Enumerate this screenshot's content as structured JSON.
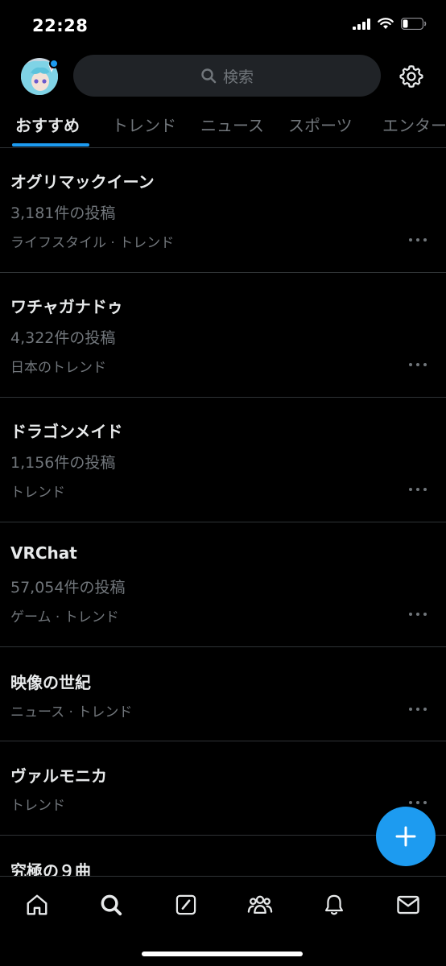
{
  "status_bar": {
    "time": "22:28"
  },
  "search": {
    "placeholder": "検索"
  },
  "tabs": [
    {
      "label": "おすすめ",
      "active": true
    },
    {
      "label": "トレンド"
    },
    {
      "label": "ニュース"
    },
    {
      "label": "スポーツ"
    },
    {
      "label": "エンター"
    }
  ],
  "trends": [
    {
      "title": "オグリマックイーン",
      "count": "3,181件の投稿",
      "context": "ライフスタイル · トレンド"
    },
    {
      "title": "ワチャガナドゥ",
      "count": "4,322件の投稿",
      "context": "日本のトレンド"
    },
    {
      "title": "ドラゴンメイド",
      "count": "1,156件の投稿",
      "context": "トレンド"
    },
    {
      "title": "VRChat",
      "count": "57,054件の投稿",
      "context": "ゲーム · トレンド"
    },
    {
      "title": "映像の世紀",
      "context": "ニュース · トレンド"
    },
    {
      "title": "ヴァルモニカ",
      "context": "トレンド"
    },
    {
      "title": "究極の９曲"
    }
  ],
  "colors": {
    "accent": "#1d9bf0",
    "background": "#000000",
    "divider": "#2f3336",
    "muted": "#71767b"
  },
  "bottom_nav": [
    "home-icon",
    "search-icon",
    "grok-icon",
    "communities-icon",
    "notifications-icon",
    "messages-icon"
  ]
}
